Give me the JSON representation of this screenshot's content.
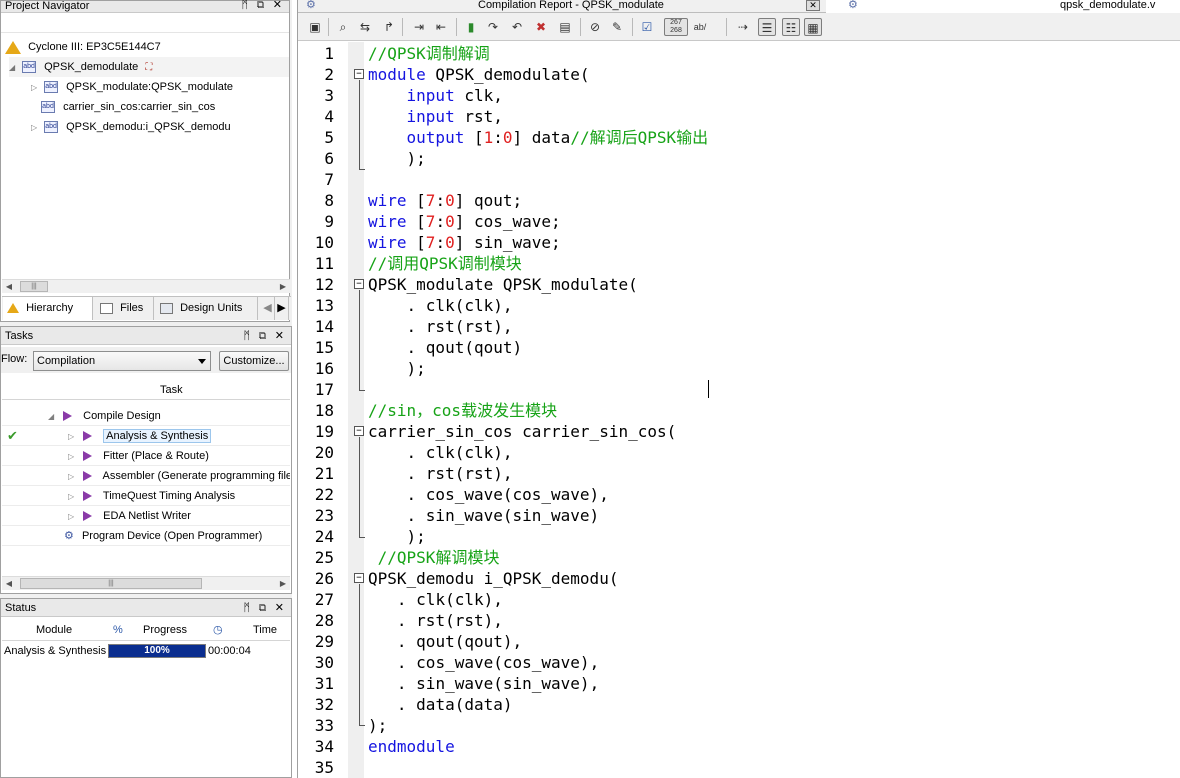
{
  "project_navigator": {
    "title": "Project Navigator",
    "panel_controls": "ᛗ ⧉ ✕",
    "device": "Cyclone III: EP3C5E144C7",
    "top_entity": "QPSK_demodulate",
    "children": [
      {
        "label": "QPSK_modulate:QPSK_modulate"
      },
      {
        "label": "carrier_sin_cos:carrier_sin_cos"
      },
      {
        "label": "QPSK_demodu:i_QPSK_demodu"
      }
    ],
    "tabs": {
      "hierarchy": "Hierarchy",
      "files": "Files",
      "design_units": "Design Units"
    }
  },
  "tasks": {
    "title": "Tasks",
    "panel_controls": "ᛗ ⧉ ✕",
    "flow_label": "Flow:",
    "flow_value": "Compilation",
    "customize_label": "Customize...",
    "column_header": "Task",
    "items": [
      {
        "label": "Compile Design"
      },
      {
        "label": "Analysis & Synthesis"
      },
      {
        "label": "Fitter (Place & Route)"
      },
      {
        "label": "Assembler (Generate programming files)"
      },
      {
        "label": "TimeQuest Timing Analysis"
      },
      {
        "label": "EDA Netlist Writer"
      },
      {
        "label": "Program Device (Open Programmer)"
      }
    ]
  },
  "status": {
    "title": "Status",
    "panel_controls": "ᛗ ⧉ ✕",
    "headers": {
      "module": "Module",
      "percent": "%",
      "progress": "Progress",
      "time": "Time"
    },
    "rows": [
      {
        "module": "Analysis & Synthesis",
        "progress": 1.0,
        "progress_label": "100%",
        "time": "00:00:04"
      }
    ]
  },
  "document_tabs": {
    "compilation_report": "Compilation Report - QPSK_modulate",
    "source_file": "qpsk_demodulate.v"
  },
  "editor": {
    "lines": [
      "1",
      "2",
      "3",
      "4",
      "5",
      "6",
      "7",
      "8",
      "9",
      "10",
      "11",
      "12",
      "13",
      "14",
      "15",
      "16",
      "17",
      "18",
      "19",
      "20",
      "21",
      "22",
      "23",
      "24",
      "25",
      "26",
      "27",
      "28",
      "29",
      "30",
      "31",
      "32",
      "33",
      "34",
      "35"
    ],
    "code": {
      "l1": "//QPSK调制解调",
      "l2_kw": "module",
      "l2_rest": " QPSK_demodulate(",
      "l3_kw": "input",
      "l3_rest": " clk,",
      "l4_kw": "input",
      "l4_rest": " rst,",
      "l5_kw": "output",
      "l5_a": " [",
      "l5_n1": "1",
      "l5_b": ":",
      "l5_n2": "0",
      "l5_c": "] data",
      "l5_cm": "//解调后QPSK输出",
      "l6": ");",
      "l8_kw": "wire",
      "l8_a": " [",
      "l8_n1": "7",
      "l8_b": ":",
      "l8_n2": "0",
      "l8_c": "] qout;",
      "l9_kw": "wire",
      "l9_a": " [",
      "l9_n1": "7",
      "l9_b": ":",
      "l9_n2": "0",
      "l9_c": "] cos_wave;",
      "l10_kw": "wire",
      "l10_a": " [",
      "l10_n1": "7",
      "l10_b": ":",
      "l10_n2": "0",
      "l10_c": "] sin_wave;",
      "l11": "//调用QPSK调制模块",
      "l12": "QPSK_modulate QPSK_modulate(",
      "l13": ". clk(clk),",
      "l14": ". rst(rst),",
      "l15": ". qout(qout)",
      "l16": ");",
      "l18": "//sin，cos载波发生模块",
      "l19": "carrier_sin_cos carrier_sin_cos(",
      "l20": ". clk(clk),",
      "l21": ". rst(rst),",
      "l22": ". cos_wave(cos_wave),",
      "l23": ". sin_wave(sin_wave)",
      "l24": ");",
      "l25": "//QPSK解调模块",
      "l26": "QPSK_demodu i_QPSK_demodu(",
      "l27": ". clk(clk),",
      "l28": ". rst(rst),",
      "l29": ". qout(qout),",
      "l30": ". cos_wave(cos_wave),",
      "l31": ". sin_wave(sin_wave),",
      "l32": ". data(data)",
      "l33": ");",
      "l34": "endmodule"
    }
  },
  "colors": {
    "keyword": "#1414e0",
    "number": "#e02020",
    "comment": "#17a317",
    "progress_fill": "#0a2d8f",
    "checkmark": "#3a9b2a"
  }
}
